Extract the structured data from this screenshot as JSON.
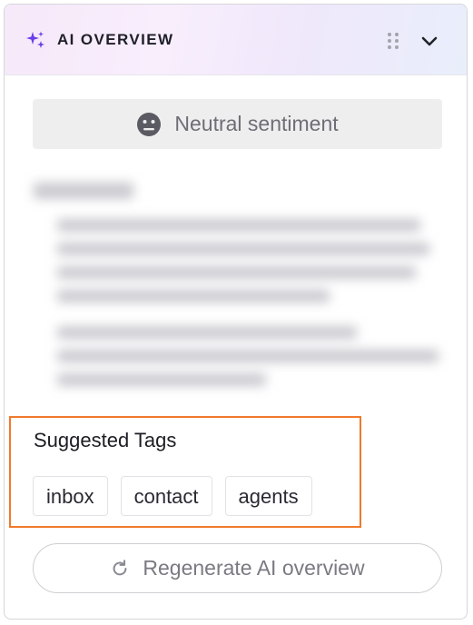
{
  "header": {
    "title": "AI OVERVIEW",
    "icon": "sparkle-icon",
    "accent_color": "#6a3de8"
  },
  "sentiment": {
    "label": "Neutral sentiment",
    "icon": "neutral-face-icon"
  },
  "suggested_tags": {
    "title": "Suggested Tags",
    "tags": [
      "inbox",
      "contact",
      "agents"
    ],
    "highlight_color": "#f07a2c"
  },
  "regenerate": {
    "label": "Regenerate AI overview",
    "icon": "refresh-icon"
  }
}
